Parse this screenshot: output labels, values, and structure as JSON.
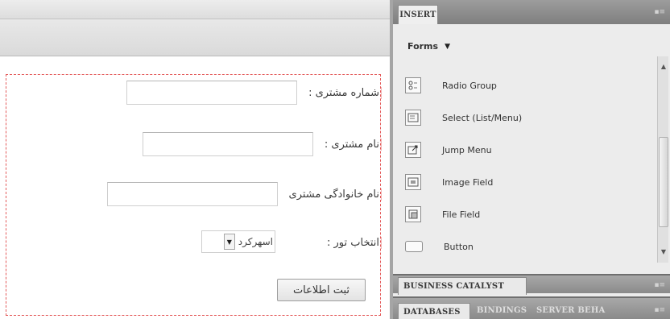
{
  "design_view": {
    "form": {
      "fields": [
        {
          "label": "شماره مشتری :"
        },
        {
          "label": "نام مشتری :"
        },
        {
          "label": "نام خانوادگی مشتری"
        },
        {
          "label": "انتخاب تور :"
        }
      ],
      "select_value": "اسهرکرد",
      "submit_label": "ثبت اطلاعات"
    }
  },
  "insert_panel": {
    "tab": "INSERT",
    "category": "Forms",
    "items": [
      {
        "label": "Radio Group",
        "icon": "radio-group-icon"
      },
      {
        "label": "Select (List/Menu)",
        "icon": "select-list-icon"
      },
      {
        "label": "Jump Menu",
        "icon": "jump-menu-icon"
      },
      {
        "label": "Image Field",
        "icon": "image-field-icon"
      },
      {
        "label": "File Field",
        "icon": "file-field-icon"
      },
      {
        "label": "Button",
        "icon": "button-icon"
      }
    ]
  },
  "lower_panels": {
    "business_catalyst_tab": "BUSINESS CATALYST",
    "databases_tab": "DATABASES",
    "bindings_tab": "BINDINGS",
    "server_tab": "SERVER BEHA"
  }
}
